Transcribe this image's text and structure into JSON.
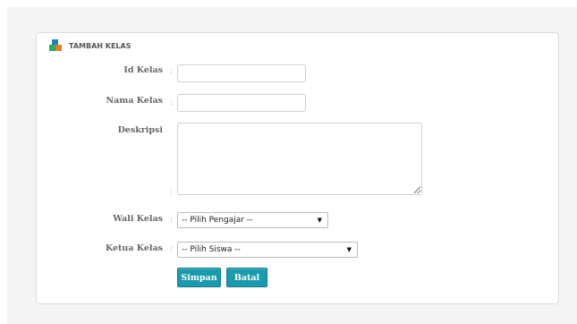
{
  "panel": {
    "title": "TAMBAH KELAS",
    "icon": "blocks-icon"
  },
  "form": {
    "id_kelas": {
      "label": "Id Kelas",
      "colon": ":",
      "value": "",
      "placeholder": ""
    },
    "nama_kelas": {
      "label": "Nama Kelas",
      "colon": ":",
      "value": "",
      "placeholder": ""
    },
    "deskripsi": {
      "label": "Deskripsi",
      "colon": ":",
      "value": ""
    },
    "wali_kelas": {
      "label": "Wali Kelas",
      "colon": ":",
      "selected": "-- Pilih Pengajar --"
    },
    "ketua_kelas": {
      "label": "Ketua Kelas",
      "colon": ":",
      "selected": "-- Pilih Siswa --"
    }
  },
  "buttons": {
    "save": "Simpan",
    "cancel": "Batal"
  },
  "colors": {
    "button": "#1a9bad",
    "panel_border": "#dcdcdc"
  }
}
